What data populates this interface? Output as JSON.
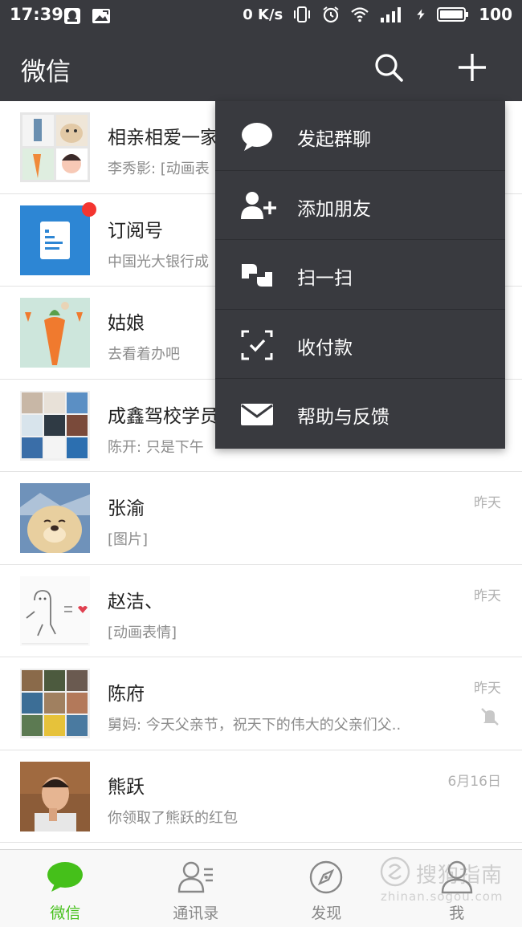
{
  "status_bar": {
    "time": "17:39",
    "net_speed": "0 K/s",
    "battery": "100"
  },
  "header": {
    "title": "微信",
    "search_icon": "search-icon",
    "plus_icon": "plus-icon"
  },
  "chats": [
    {
      "name": "相亲相爱一家",
      "preview": "李秀影: [动画表",
      "time": "",
      "avatar": "grid-avatar-family",
      "muted": false,
      "badge": false
    },
    {
      "name": "订阅号",
      "preview": "中国光大银行成",
      "time": "",
      "avatar": "subscription-avatar",
      "muted": false,
      "badge": true
    },
    {
      "name": "姑娘",
      "preview": "去看着办吧",
      "time": "",
      "avatar": "carrot-avatar",
      "muted": false,
      "badge": false
    },
    {
      "name": "成鑫驾校学员",
      "preview": "陈开: 只是下午",
      "time": "",
      "avatar": "grid-avatar-school",
      "muted": true,
      "badge": false
    },
    {
      "name": "张渝",
      "preview": "[图片]",
      "time": "昨天",
      "avatar": "dog-avatar",
      "muted": false,
      "badge": false
    },
    {
      "name": "赵洁、",
      "preview": "[动画表情]",
      "time": "昨天",
      "avatar": "sketch-avatar",
      "muted": false,
      "badge": false
    },
    {
      "name": "陈府",
      "preview": "舅妈: 今天父亲节，祝天下的伟大的父亲们父..",
      "time": "昨天",
      "avatar": "grid-avatar-family2",
      "muted": true,
      "badge": false
    },
    {
      "name": "熊跃",
      "preview": "你领取了熊跃的红包",
      "time": "6月16日",
      "avatar": "person-avatar",
      "muted": false,
      "badge": false
    }
  ],
  "menu": {
    "items": [
      {
        "label": "发起群聊",
        "icon": "chat-bubble-icon"
      },
      {
        "label": "添加朋友",
        "icon": "add-friend-icon"
      },
      {
        "label": "扫一扫",
        "icon": "scan-icon"
      },
      {
        "label": "收付款",
        "icon": "pay-icon"
      },
      {
        "label": "帮助与反馈",
        "icon": "mail-icon"
      }
    ]
  },
  "tabs": [
    {
      "label": "微信",
      "icon": "chat-tab-icon",
      "active": true
    },
    {
      "label": "通讯录",
      "icon": "contacts-tab-icon",
      "active": false
    },
    {
      "label": "发现",
      "icon": "compass-tab-icon",
      "active": false
    },
    {
      "label": "我",
      "icon": "me-tab-icon",
      "active": false
    }
  ],
  "watermark": {
    "main": "搜狗指南",
    "sub": "zhinan.sogou.com"
  },
  "colors": {
    "header_bg": "#393a3f",
    "active_tab": "#45c01a",
    "badge": "#f43530"
  }
}
